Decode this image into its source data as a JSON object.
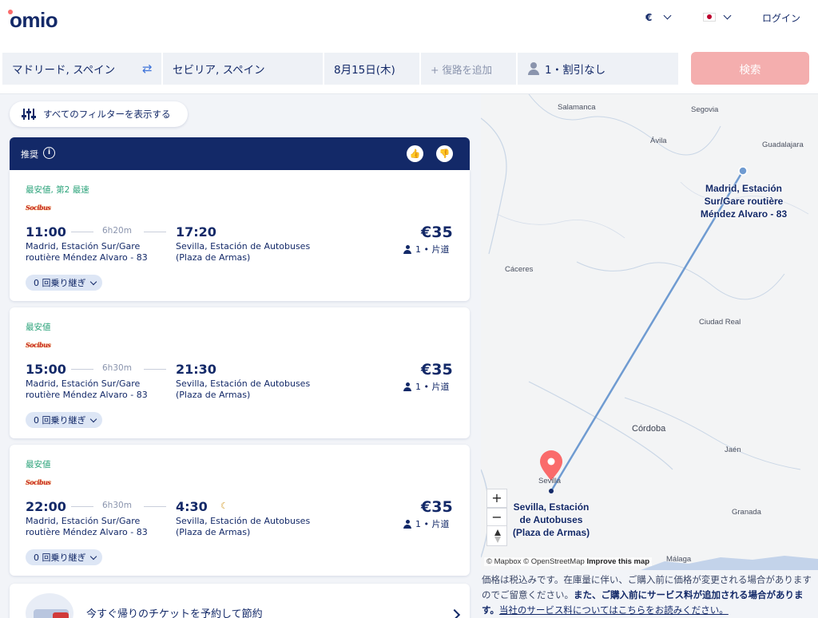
{
  "header": {
    "logo": "omio",
    "currency": "€",
    "login": "ログイン"
  },
  "search": {
    "from": "マドリード, スペイン",
    "to": "セビリア, スペイン",
    "date": "8月15日(木)",
    "return_placeholder": "+ 復路を追加",
    "passengers": "1・割引なし",
    "search_button": "検索"
  },
  "filters": {
    "show_all": "すべてのフィルターを表示する"
  },
  "recommended": {
    "label": "推奨"
  },
  "results": [
    {
      "tag": "最安値, 第2 最速",
      "carrier": "Socibus",
      "departure": "11:00",
      "duration": "6h20m",
      "arrival": "17:20",
      "from_station_l1": "Madrid, Estación Sur/Gare",
      "from_station_l2": "routière Méndez Alvaro - 83",
      "to_station_l1": "Sevilla, Estación de Autobuses",
      "to_station_l2": "(Plaza de Armas)",
      "price": "€35",
      "pax": "1 • 片道",
      "transfers": "0 回乗り継ぎ"
    },
    {
      "tag": "最安値",
      "carrier": "Socibus",
      "departure": "15:00",
      "duration": "6h30m",
      "arrival": "21:30",
      "from_station_l1": "Madrid, Estación Sur/Gare",
      "from_station_l2": "routière Méndez Alvaro - 83",
      "to_station_l1": "Sevilla, Estación de Autobuses",
      "to_station_l2": "(Plaza de Armas)",
      "price": "€35",
      "pax": "1 • 片道",
      "transfers": "0 回乗り継ぎ"
    },
    {
      "tag": "最安値",
      "carrier": "Socibus",
      "departure": "22:00",
      "duration": "6h30m",
      "arrival": "4:30",
      "from_station_l1": "Madrid, Estación Sur/Gare",
      "from_station_l2": "routière Méndez Alvaro - 83",
      "to_station_l1": "Sevilla, Estación de Autobuses",
      "to_station_l2": "(Plaza de Armas)",
      "price": "€35",
      "pax": "1 • 片道",
      "transfers": "0 回乗り継ぎ"
    }
  ],
  "promo": {
    "text": "今すぐ帰りのチケットを予約して節約"
  },
  "map": {
    "cities": {
      "salamanca": "Salamanca",
      "segovia": "Segovia",
      "avila": "Ávila",
      "guadalajara": "Guadalajara",
      "caceres": "Cáceres",
      "ciudad_real": "Ciudad Real",
      "cordoba": "Córdoba",
      "jaen": "Jaén",
      "granada": "Granada",
      "sevilla": "Sevilla",
      "malaga": "Málaga"
    },
    "origin_label_l1": "Madrid, Estación",
    "origin_label_l2": "Sur/Gare routière",
    "origin_label_l3": "Méndez Alvaro - 83",
    "dest_label_l1": "Sevilla, Estación",
    "dest_label_l2": "de Autobuses",
    "dest_label_l3": "(Plaza de Armas)",
    "zoom_in": "+",
    "zoom_out": "−",
    "attribution_mapbox": "© Mapbox",
    "attribution_osm": "© OpenStreetMap",
    "improve": "Improve this map",
    "route_color": "#6f9bd1",
    "pin_color": "#fa6b6b"
  },
  "disclaimer": {
    "part1": "価格は税込みです。在庫量に伴い、ご購入前に価格が変更される場合がありますのでご留意ください。",
    "bold": "また、ご購入前にサービス料が追加される場合があります。",
    "link": "当社のサービス料についてはこちらをお読みください。"
  }
}
